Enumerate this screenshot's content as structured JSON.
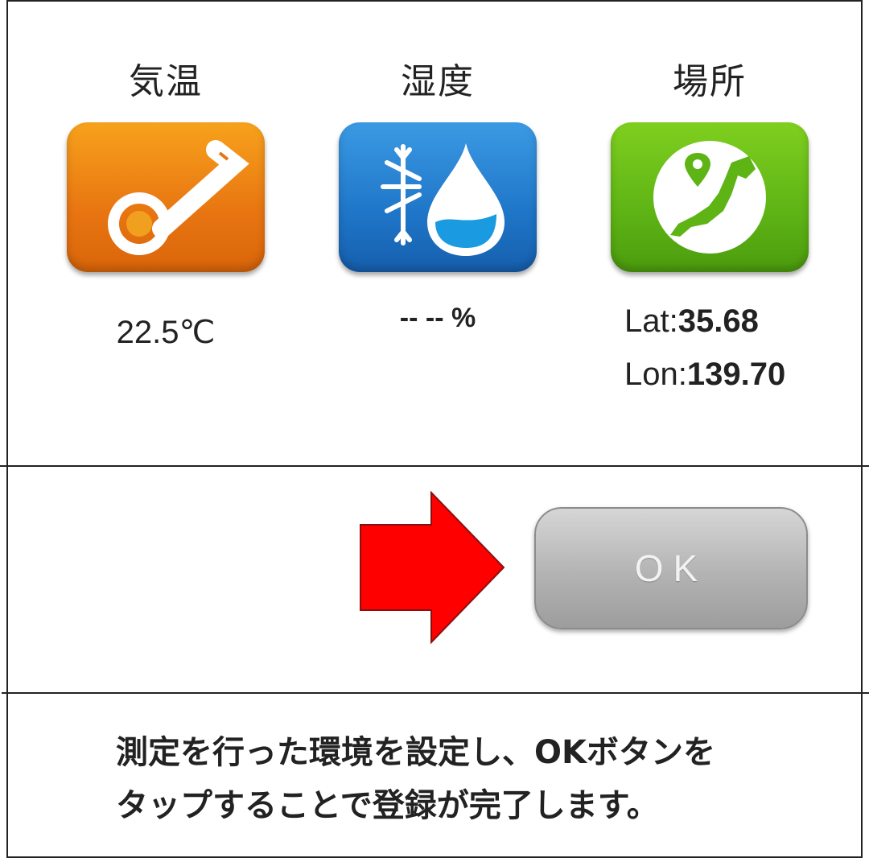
{
  "columns": {
    "temperature": {
      "title": "気温",
      "value": "22.5℃",
      "icon": "thermometer-icon",
      "color": "#e87511"
    },
    "humidity": {
      "title": "湿度",
      "value": "-- -- %",
      "icon": "snow-water-drop-icon",
      "color": "#1f76c8"
    },
    "location": {
      "title": "場所",
      "icon": "japan-map-pin-icon",
      "color": "#5eb415",
      "lat_label": "Lat:",
      "lat_value": "35.68",
      "lon_label": "Lon:",
      "lon_value": "139.70"
    }
  },
  "arrow": {
    "icon": "right-arrow-icon",
    "color": "#ff0000"
  },
  "ok_button": {
    "label": "OK"
  },
  "instructions": {
    "line1": "測定を行った環境を設定し、OKボタンを",
    "line2": "タップすることで登録が完了します。"
  }
}
